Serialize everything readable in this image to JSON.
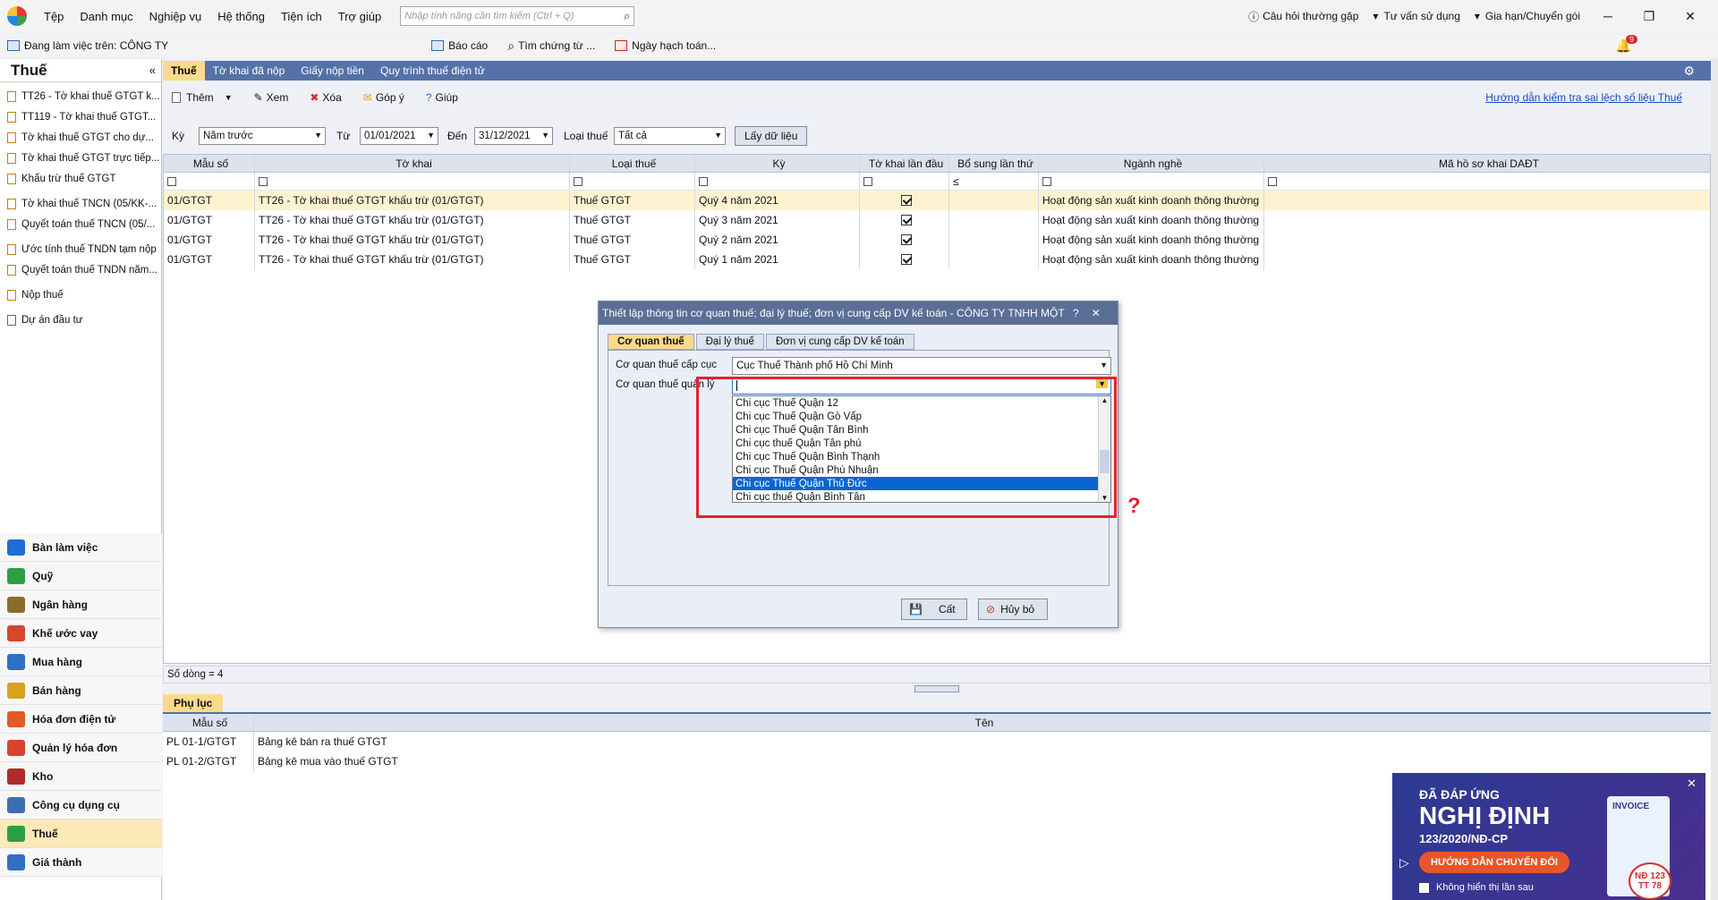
{
  "menu": {
    "items": [
      "Tệp",
      "Danh mục",
      "Nghiệp vụ",
      "Hệ thống",
      "Tiện ích",
      "Trợ giúp"
    ],
    "search_placeholder": "Nhập tính năng cần tìm kiếm (Ctrl + Q)"
  },
  "topright": {
    "faq": "Câu hỏi thường gặp",
    "consult": "Tư vấn sử dụng",
    "renew": "Gia hạn/Chuyển gói",
    "notif_count": "9"
  },
  "toolbar2": {
    "working_on": "Đang làm việc trên:  CÔNG TY",
    "report": "Báo cáo",
    "find_voucher": "Tìm chứng từ ...",
    "posting_date": "Ngày hạch toán..."
  },
  "sidebar": {
    "title": "Thuế",
    "items": [
      "TT26 - Tờ khai thuế GTGT k...",
      "TT119 - Tờ khai thuế GTGT...",
      "Tờ khai thuế GTGT cho dự...",
      "Tờ khai thuế GTGT trực tiếp...",
      "Khấu trừ thuế GTGT",
      "Tờ khai thuế TNCN (05/KK-...",
      "Quyết toán thuế TNCN (05/...",
      "Ước tính thuế TNDN tạm nộp",
      "Quyết toán thuế TNDN năm...",
      "Nộp thuế",
      "Dự án đầu tư"
    ],
    "modules": [
      "Bàn làm việc",
      "Quỹ",
      "Ngân hàng",
      "Khế ước vay",
      "Mua hàng",
      "Bán hàng",
      "Hóa đơn điện tử",
      "Quản lý hóa đơn",
      "Kho",
      "Công cụ dụng cụ",
      "Thuế",
      "Giá thành"
    ]
  },
  "tabs": [
    "Thuế",
    "Tờ khai đã nộp",
    "Giấy nộp tiền",
    "Quy trình thuế điện tử"
  ],
  "actions": {
    "add": "Thêm",
    "view": "Xem",
    "delete": "Xóa",
    "feedback": "Góp ý",
    "help": "Giúp",
    "guide_link": "Hướng dẫn kiểm tra sai lệch số liệu Thuế"
  },
  "filter": {
    "period_label": "Kỳ",
    "period_value": "Năm trước",
    "from_label": "Từ",
    "from_value": "01/01/2021",
    "to_label": "Đến",
    "to_value": "31/12/2021",
    "type_label": "Loại thuế",
    "type_value": "Tất cả",
    "get_data": "Lấy dữ liệu"
  },
  "grid": {
    "headers": [
      "Mẫu số",
      "Tờ khai",
      "Loại thuế",
      "Kỳ",
      "Tờ khai lần đầu",
      "Bổ sung lần thứ",
      "Ngành nghề",
      "Mã hồ sơ khai DAĐT"
    ],
    "filter_op": "≤",
    "rows": [
      {
        "mau_so": "01/GTGT",
        "to_khai": "TT26 - Tờ khai thuế GTGT khấu trừ (01/GTGT)",
        "loai_thue": "Thuế GTGT",
        "ky": "Quý 4 năm 2021",
        "lan_dau": true,
        "nganh_nghe": "Hoạt động sản xuất kinh doanh thông thường"
      },
      {
        "mau_so": "01/GTGT",
        "to_khai": "TT26 - Tờ khai thuế GTGT khấu trừ (01/GTGT)",
        "loai_thue": "Thuế GTGT",
        "ky": "Quý 3 năm 2021",
        "lan_dau": true,
        "nganh_nghe": "Hoạt động sản xuất kinh doanh thông thường"
      },
      {
        "mau_so": "01/GTGT",
        "to_khai": "TT26 - Tờ khai thuế GTGT khấu trừ (01/GTGT)",
        "loai_thue": "Thuế GTGT",
        "ky": "Quý 2 năm 2021",
        "lan_dau": true,
        "nganh_nghe": "Hoạt động sản xuất kinh doanh thông thường"
      },
      {
        "mau_so": "01/GTGT",
        "to_khai": "TT26 - Tờ khai thuế GTGT khấu trừ (01/GTGT)",
        "loai_thue": "Thuế GTGT",
        "ky": "Quý 1 năm 2021",
        "lan_dau": true,
        "nganh_nghe": "Hoạt động sản xuất kinh doanh thông thường"
      }
    ],
    "row_count": "Số dòng = 4"
  },
  "appendix": {
    "tab": "Phụ lục",
    "headers": [
      "Mẫu số",
      "Tên"
    ],
    "rows": [
      {
        "mau_so": "PL 01-1/GTGT",
        "ten": "Bảng kê bán ra thuế GTGT"
      },
      {
        "mau_so": "PL 01-2/GTGT",
        "ten": "Bảng kê mua vào thuế GTGT"
      }
    ]
  },
  "dialog": {
    "title": "Thiết lập thông tin cơ quan thuế; đại lý thuế; đơn vị cung cấp DV kế toán - CÔNG TY TNHH MỘT T...",
    "tabs": [
      "Cơ quan thuế",
      "Đại lý thuế",
      "Đơn vị cung cấp DV kế toán"
    ],
    "cuc_label": "Cơ quan thuế cấp cục",
    "cuc_value": "Cục Thuế Thành phố Hồ Chí Minh",
    "qly_label": "Cơ quan thuế quản lý",
    "qly_value": "",
    "options": [
      "Chi cục Thuế Quận 12",
      "Chi cục Thuế Quận Gò Vấp",
      "Chi cục Thuế Quận Tân Bình",
      "Chi cục thuế Quận Tân phú",
      "Chi cục Thuế Quận Bình Thạnh",
      "Chi cục Thuế Quận Phú Nhuận",
      "Chi cục Thuế Quận Thủ Đức",
      "Chi cục thuế Quận Bình Tân"
    ],
    "highlighted_option": "Chi cục Thuế Quận Thủ Đức",
    "save": "Cất",
    "cancel": "Hủy bỏ"
  },
  "annotation": {
    "question_mark": "?"
  },
  "promo": {
    "line1": "ĐÃ ĐÁP ỨNG",
    "line2": "NGHỊ ĐỊNH",
    "line3": "123/2020/NĐ-CP",
    "button": "HƯỚNG DẪN CHUYỂN ĐỔI",
    "invoice": "INVOICE",
    "badge1": "NĐ 123",
    "badge2": "TT 78",
    "dont_show": "Không hiển thị lần sau"
  },
  "colors": {
    "header_blue": "#5472a8",
    "active_tab": "#fcd98c",
    "highlight_red": "#e3232b",
    "selection_blue": "#0a64d4"
  }
}
